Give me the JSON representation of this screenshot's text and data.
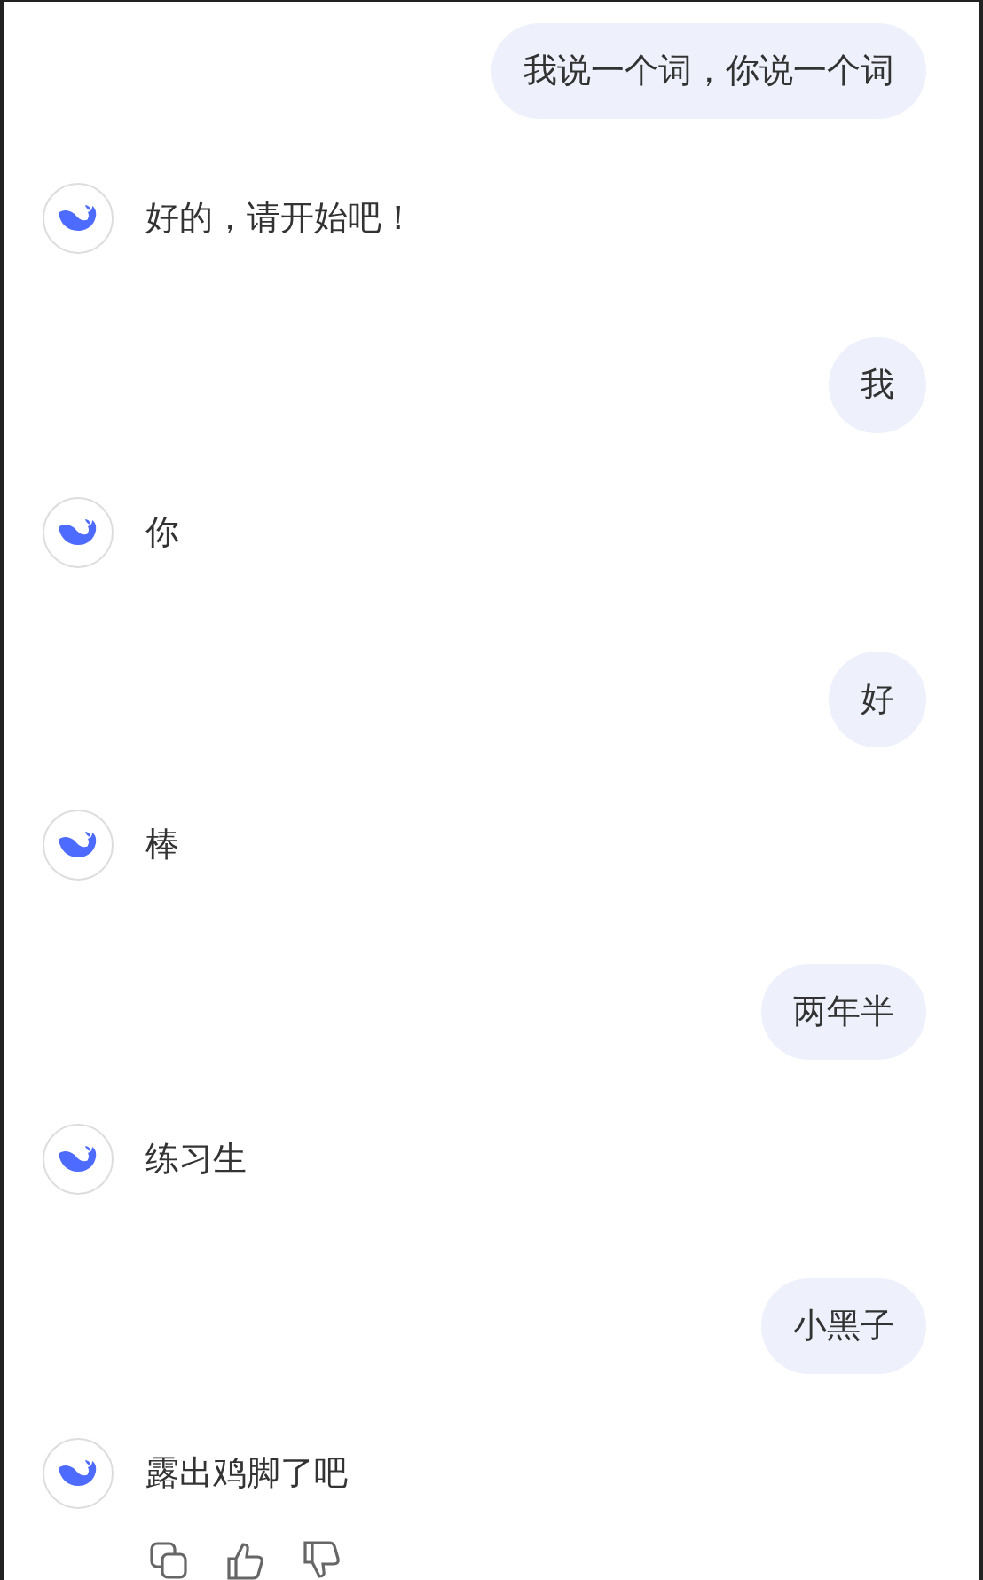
{
  "messages": [
    {
      "kind": "user",
      "text": "我说一个词，你说一个词"
    },
    {
      "kind": "assistant",
      "text": "好的，请开始吧！"
    },
    {
      "kind": "user",
      "text": "我"
    },
    {
      "kind": "assistant",
      "text": "你"
    },
    {
      "kind": "user",
      "text": "好"
    },
    {
      "kind": "assistant",
      "text": "棒"
    },
    {
      "kind": "user",
      "text": "两年半"
    },
    {
      "kind": "assistant",
      "text": "练习生"
    },
    {
      "kind": "user",
      "text": "小黑子"
    },
    {
      "kind": "assistant",
      "text": "露出鸡脚了吧"
    }
  ]
}
